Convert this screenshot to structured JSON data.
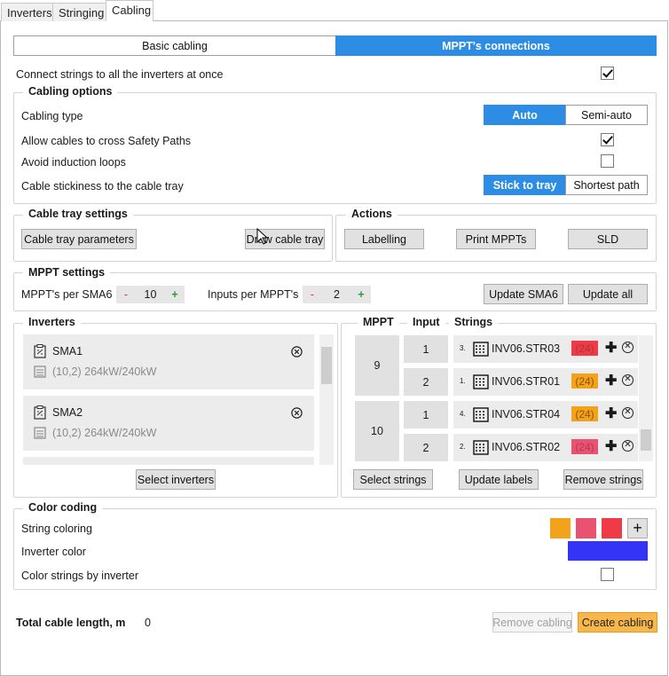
{
  "tabs": [
    "Inverters",
    "Stringing",
    "Cabling"
  ],
  "mode": {
    "basic": "Basic cabling",
    "mppt": "MPPT's connections"
  },
  "connect_all": {
    "label": "Connect strings to all the inverters at once",
    "checked": true
  },
  "cabling_options": {
    "title": "Cabling options",
    "type_label": "Cabling type",
    "type_auto": "Auto",
    "type_semi": "Semi-auto",
    "cross_label": "Allow cables to cross Safety Paths",
    "loops_label": "Avoid induction loops",
    "stickiness_label": "Cable stickiness to the cable tray",
    "stick_on": "Stick to tray",
    "stick_short": "Shortest path"
  },
  "tray": {
    "title": "Cable tray settings",
    "params": "Cable tray parameters",
    "draw": "Draw cable tray"
  },
  "actions": {
    "title": "Actions",
    "labelling": "Labelling",
    "print": "Print MPPTs",
    "sld": "SLD"
  },
  "mppt_settings": {
    "title": "MPPT settings",
    "per_label": "MPPT's per SMA6",
    "minus": "-",
    "plus": "+",
    "per_value": "10",
    "inputs_label": "Inputs per MPPT's",
    "inputs_value": "2",
    "update": "Update SMA6",
    "update_all": "Update all"
  },
  "inverters": {
    "title": "Inverters",
    "items": [
      {
        "name": "SMA1",
        "info": "(10,2)  264kW/240kW"
      },
      {
        "name": "SMA2",
        "info": "(10,2)  264kW/240kW"
      }
    ],
    "select": "Select inverters"
  },
  "strings_table": {
    "head_mppt": "MPPT",
    "head_input": "Input",
    "head_strings": "Strings",
    "mppts": [
      "9",
      "10"
    ],
    "rows": [
      {
        "input": "1",
        "idx": "3.",
        "name": "INV06.STR03",
        "count": "(24)",
        "color": "#ee3b47",
        "count_color": "#b0333b"
      },
      {
        "input": "2",
        "idx": "1.",
        "name": "INV06.STR01",
        "count": "(24)",
        "color": "#f3a31b",
        "count_color": "#8a5300"
      },
      {
        "input": "1",
        "idx": "4.",
        "name": "INV06.STR04",
        "count": "(24)",
        "color": "#f3a31b",
        "count_color": "#8a5300"
      },
      {
        "input": "2",
        "idx": "2.",
        "name": "INV06.STR02",
        "count": "(24)",
        "color": "#ea5272",
        "count_color": "#b03a52"
      }
    ],
    "plus": "✚",
    "remove_glyph": "✕",
    "select": "Select strings",
    "update_labels": "Update labels",
    "remove": "Remove strings"
  },
  "color_coding": {
    "title": "Color coding",
    "string_label": "String coloring",
    "swatches": [
      "#f3a31b",
      "#ea5272",
      "#ee3b47"
    ],
    "add": "+",
    "inverter_label": "Inverter color",
    "inverter_color": "#3434f5",
    "by_inverter_label": "Color strings by inverter"
  },
  "footer": {
    "total_label": "Total cable length, m",
    "total_value": "0",
    "remove": "Remove cabling",
    "create": "Create cabling"
  }
}
